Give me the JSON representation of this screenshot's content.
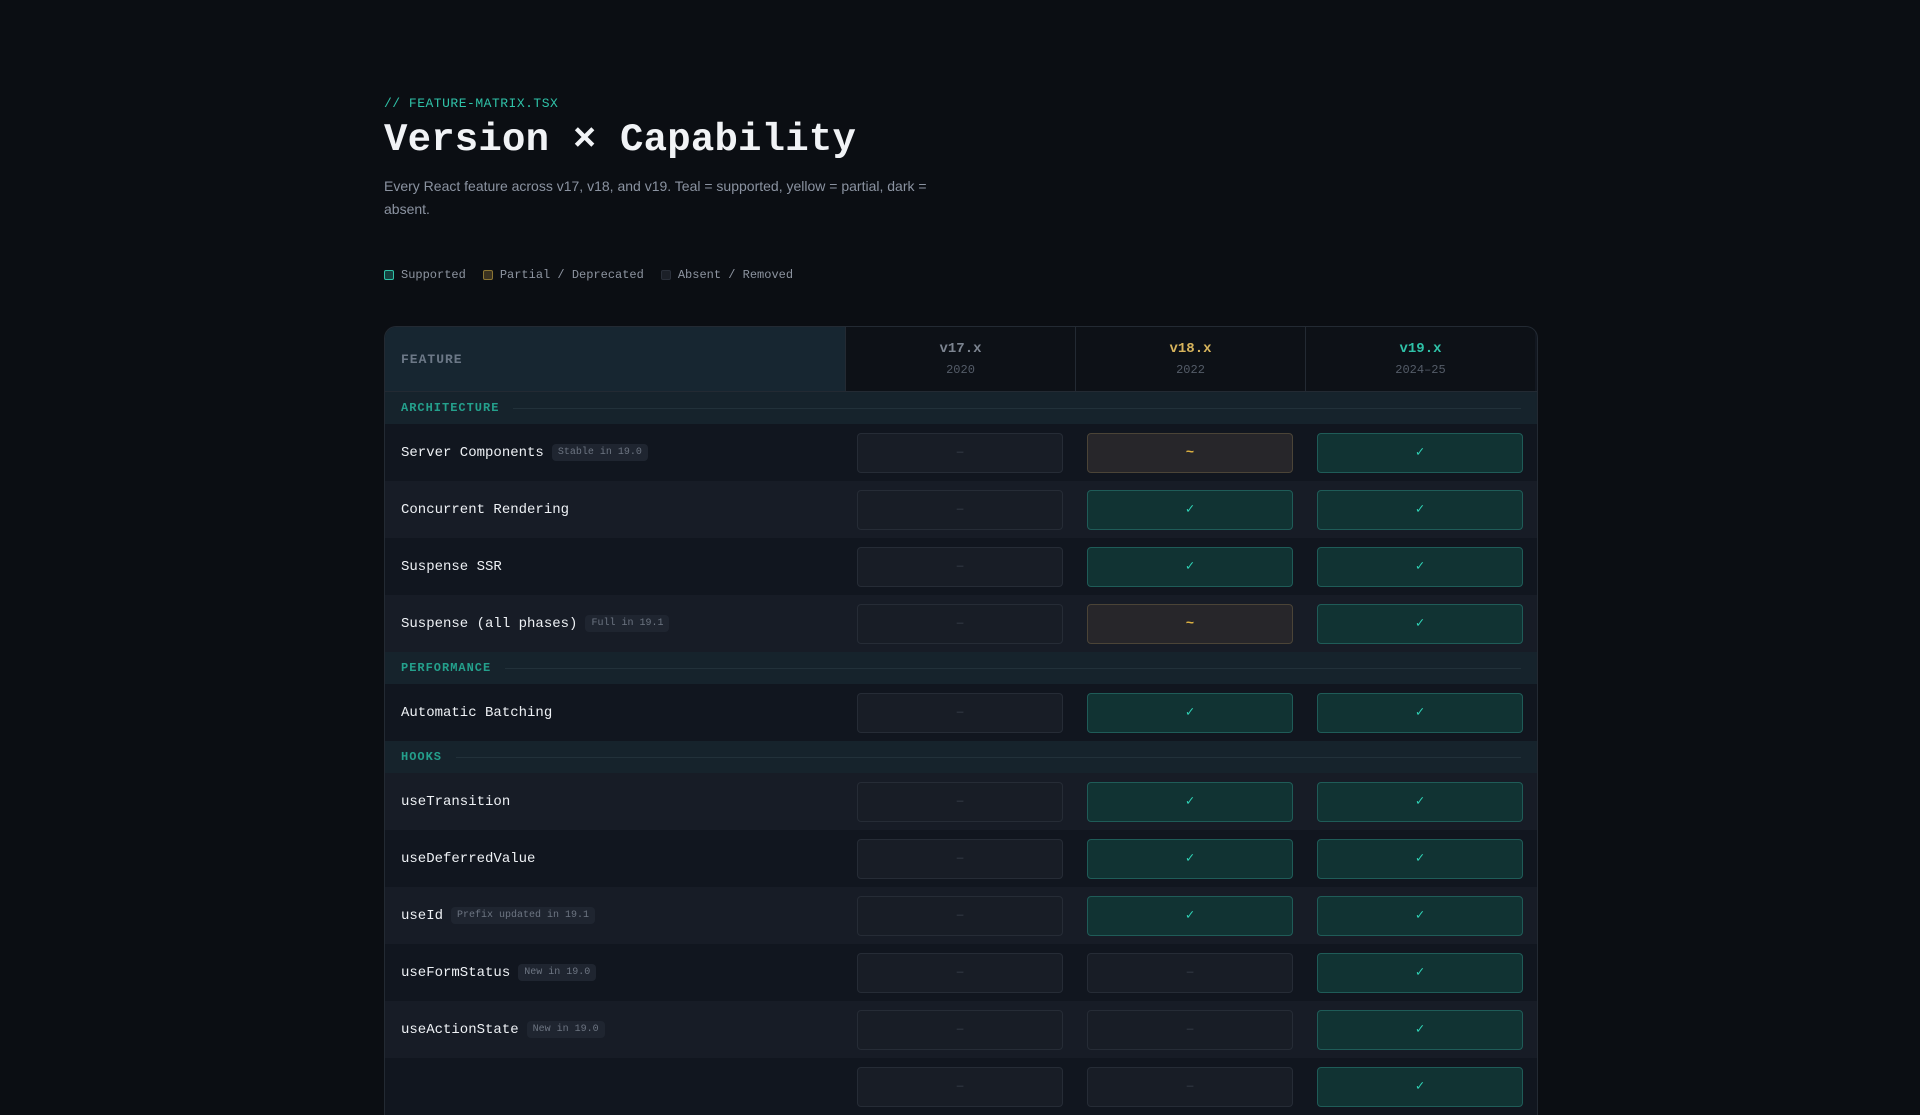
{
  "header": {
    "kicker": "// FEATURE-MATRIX.TSX",
    "title": "Version × Capability",
    "subtitle": "Every React feature across v17, v18, and v19. Teal = supported, yellow = partial, dark = absent."
  },
  "legend": {
    "supported": "Supported",
    "partial": "Partial / Deprecated",
    "absent": "Absent / Removed"
  },
  "colors": {
    "background": "#0b0e13",
    "accent_teal": "#2fc2a8",
    "accent_yellow": "#d7b45c",
    "supported_fill": "#113333",
    "partial_fill": "#27262a",
    "absent_fill": "#181d26"
  },
  "table": {
    "feature_header": "FEATURE",
    "versions": [
      {
        "name": "v17.x",
        "year": "2020"
      },
      {
        "name": "v18.x",
        "year": "2022"
      },
      {
        "name": "v19.x",
        "year": "2024–25"
      }
    ],
    "symbols": {
      "supported": "✓",
      "partial": "~",
      "absent": "—"
    },
    "sections": [
      {
        "label": "ARCHITECTURE",
        "rows": [
          {
            "feature": "Server Components",
            "tag": "Stable in 19.0",
            "status": [
              "absent",
              "partial",
              "supported"
            ]
          },
          {
            "feature": "Concurrent Rendering",
            "tag": "",
            "status": [
              "absent",
              "supported",
              "supported"
            ]
          },
          {
            "feature": "Suspense SSR",
            "tag": "",
            "status": [
              "absent",
              "supported",
              "supported"
            ]
          },
          {
            "feature": "Suspense (all phases)",
            "tag": "Full in 19.1",
            "status": [
              "absent",
              "partial",
              "supported"
            ]
          }
        ]
      },
      {
        "label": "PERFORMANCE",
        "rows": [
          {
            "feature": "Automatic Batching",
            "tag": "",
            "status": [
              "absent",
              "supported",
              "supported"
            ]
          }
        ]
      },
      {
        "label": "HOOKS",
        "rows": [
          {
            "feature": "useTransition",
            "tag": "",
            "status": [
              "absent",
              "supported",
              "supported"
            ]
          },
          {
            "feature": "useDeferredValue",
            "tag": "",
            "status": [
              "absent",
              "supported",
              "supported"
            ]
          },
          {
            "feature": "useId",
            "tag": "Prefix updated in 19.1",
            "status": [
              "absent",
              "supported",
              "supported"
            ]
          },
          {
            "feature": "useFormStatus",
            "tag": "New in 19.0",
            "status": [
              "absent",
              "absent",
              "supported"
            ]
          },
          {
            "feature": "useActionState",
            "tag": "New in 19.0",
            "status": [
              "absent",
              "absent",
              "supported"
            ]
          },
          {
            "feature": "",
            "tag": "",
            "status": [
              "absent",
              "absent",
              "supported"
            ]
          }
        ]
      }
    ]
  }
}
